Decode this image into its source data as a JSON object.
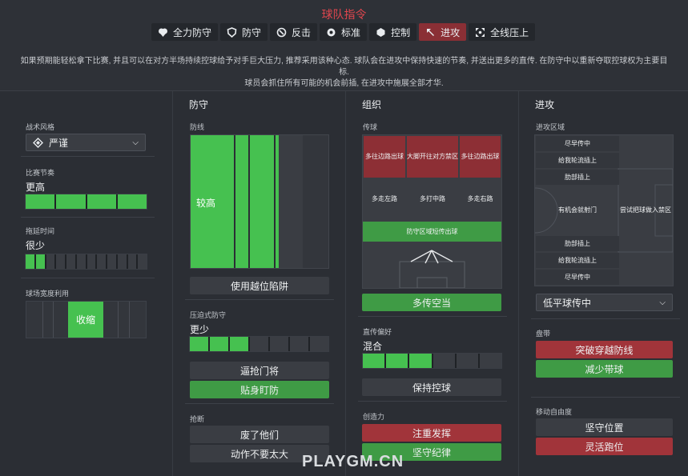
{
  "header": {
    "title": "球队指令",
    "tabs": [
      {
        "label": "全力防守",
        "icon": "shield-heart-icon"
      },
      {
        "label": "防守",
        "icon": "shield-icon"
      },
      {
        "label": "反击",
        "icon": "counter-icon"
      },
      {
        "label": "标准",
        "icon": "balanced-icon"
      },
      {
        "label": "控制",
        "icon": "control-icon"
      },
      {
        "label": "进攻",
        "icon": "attack-icon"
      },
      {
        "label": "全线压上",
        "icon": "all-out-icon"
      }
    ],
    "active_tab": "进攻",
    "description_line1": "如果预期能轻松拿下比赛, 并且可以在对方半场持续控球给予对手巨大压力, 推荐采用该种心态. 球队会在进攻中保持快速的节奏, 并送出更多的直传. 在防守中以重新夺取控球权为主要目标.",
    "description_line2": "球员会抓住所有可能的机会前插, 在进攻中施展全部才华."
  },
  "general": {
    "style_label": "战术风格",
    "style_value": "严谨",
    "tempo_label": "比赛节奏",
    "tempo_value": "更高",
    "tempo_level": 0.9,
    "timewasting_label": "拖延时间",
    "timewasting_value": "很少",
    "timewasting_level": 0.15,
    "width_label": "球场宽度利用",
    "width_value": "收缩"
  },
  "defence": {
    "heading": "防守",
    "line_label": "防线",
    "line_value": "较高",
    "offside_button": "使用越位陷阱",
    "press_label": "压迫式防守",
    "press_value": "更少",
    "press_level": 0.4,
    "distribute_gk_button": "逼抢门将",
    "tight_marking_button": "贴身盯防",
    "tackling_label": "抢断",
    "tackle_hard_button": "废了他们",
    "stay_on_feet_button": "动作不要太大"
  },
  "organisation": {
    "heading": "组织",
    "passing_label": "传球",
    "zones_top": [
      "多往边路出球",
      "大脚开往对方禁区",
      "多往边路出球"
    ],
    "zones_mid": [
      "多走左路",
      "多打中路",
      "多走右路"
    ],
    "zone_short": "防守区域短传出球",
    "overlap_button": "多传空当",
    "directness_label": "直传偏好",
    "directness_value": "混合",
    "directness_level": 0.5,
    "retain_button": "保持控球",
    "creativity_label": "创造力",
    "express_button": "注重发挥",
    "discipline_button": "坚守纪律"
  },
  "attack": {
    "heading": "进攻",
    "area_label": "进攻区域",
    "left_zones": [
      "尽早传中",
      "给我轮流插上",
      "肋部插上",
      "有机会就射门",
      "肋部插上",
      "给我轮流插上",
      "尽早传中"
    ],
    "right_zone": "尝试把球做入禁区",
    "cross_select": "低平球传中",
    "dribble_label": "盘带",
    "dribble_more_button": "突破穿越防线",
    "dribble_less_button": "减少带球",
    "movement_label": "移动自由度",
    "hold_position_button": "坚守位置",
    "roam_button": "灵活跑位"
  },
  "watermark": "PLAYGM.CN",
  "colors": {
    "accent_red": "#e0464e",
    "active_tab": "#8a2f35",
    "green": "#46c150",
    "red_btn": "#a1343a"
  }
}
